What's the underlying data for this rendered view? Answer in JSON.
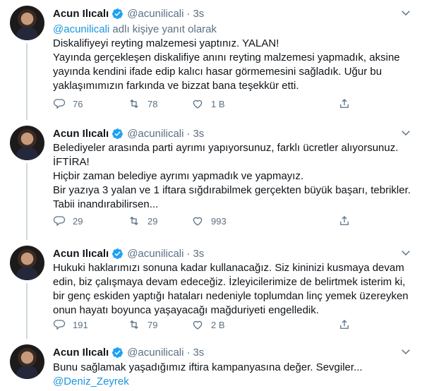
{
  "author": {
    "name": "Acun Ilıcalı",
    "handle": "@acunilicali",
    "separator": "·",
    "verified_color": "#1da1f2"
  },
  "colors": {
    "link": "#1b95e0",
    "secondary": "#5b7083",
    "divider": "#e6ecf0"
  },
  "tweets": [
    {
      "time": "3s",
      "reply_to": {
        "handle": "@acunilicali",
        "suffix": " adlı kişiye yanıt olarak"
      },
      "lines": [
        "Diskalifiyeyi reyting malzemesi yaptınız. YALAN!",
        "Yayında gerçekleşen diskalifiye anını reyting malzemesi yapmadık, aksine",
        "yayında kendini ifade edip kalıcı hasar görmemesini sağladık. Uğur bu",
        "yaklaşımımızın farkında ve bizzat bana teşekkür etti."
      ],
      "stats": {
        "replies": "76",
        "retweets": "78",
        "likes": "1 B"
      }
    },
    {
      "time": "3s",
      "lines": [
        "Belediyeler arasında parti ayrımı yapıyorsunuz, farklı ücretler alıyorsunuz.",
        "İFTİRA!",
        "Hiçbir zaman belediye ayrımı yapmadık ve yapmayız.",
        "Bir yazıya 3 yalan ve 1 iftara sığdırabilmek gerçekten büyük başarı, tebrikler.",
        "Tabii inandırabilirsen..."
      ],
      "stats": {
        "replies": "29",
        "retweets": "29",
        "likes": "993"
      }
    },
    {
      "time": "3s",
      "lines": [
        "Hukuki haklarımızı sonuna kadar kullanacağız. Siz kininizi kusmaya devam",
        "edin, biz çalışmaya devam edeceğiz. İzleyicilerimize de belirtmek isterim ki,",
        "bir genç eskiden yaptığı hataları nedeniyle toplumdan linç yemek üzereyken",
        "onun hayatı boyunca yaşayacağı mağduriyeti engelledik."
      ],
      "stats": {
        "replies": "191",
        "retweets": "79",
        "likes": "2 B"
      }
    },
    {
      "time": "3s",
      "lines": [
        "Bunu sağlamak yaşadığımız iftira kampanyasına değer. Sevgiler..."
      ],
      "mention": "@Deniz_Zeyrek"
    }
  ]
}
